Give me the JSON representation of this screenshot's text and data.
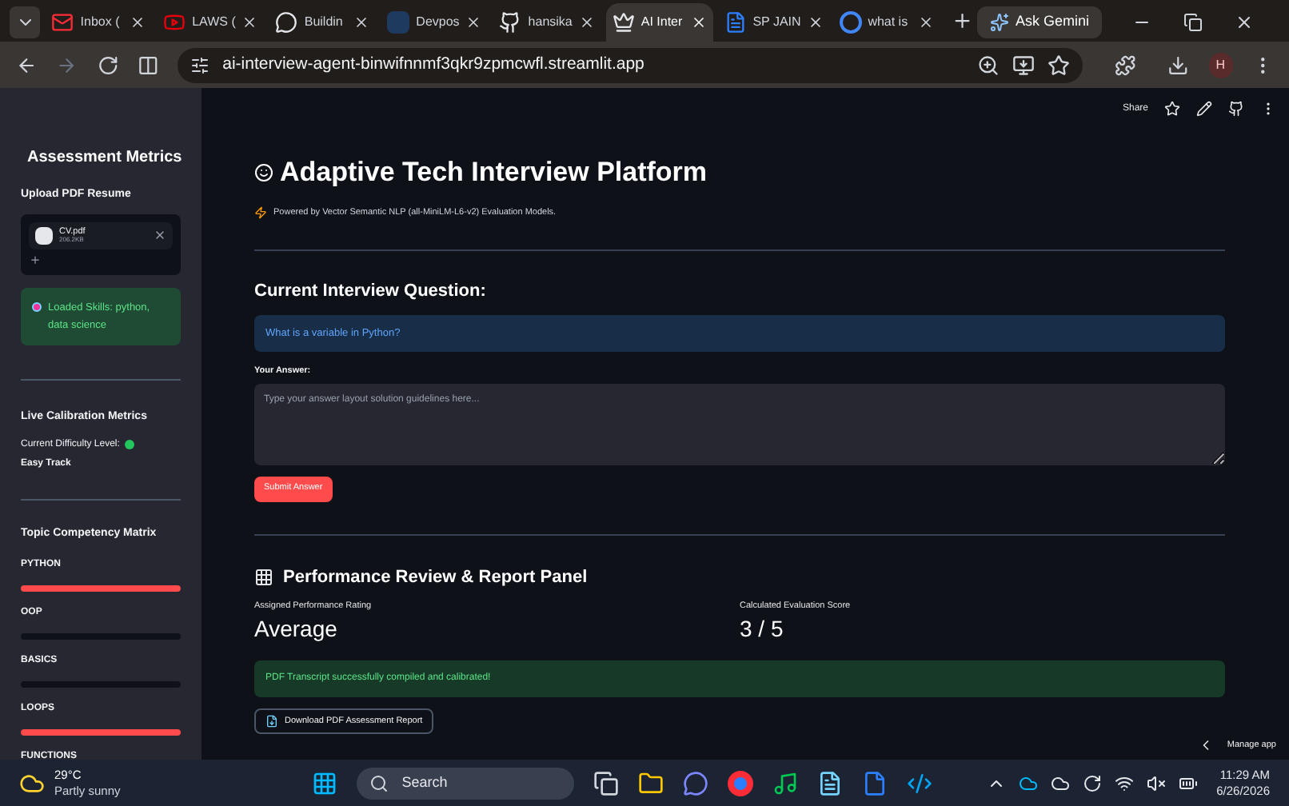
{
  "browser": {
    "tabs": [
      {
        "label": "Inbox (",
        "selected": false
      },
      {
        "label": "LAWS (",
        "selected": false
      },
      {
        "label": "Buildin",
        "selected": false
      },
      {
        "label": "Devpos",
        "selected": false
      },
      {
        "label": "hansika",
        "selected": false
      },
      {
        "label": "AI Inter",
        "selected": true
      },
      {
        "label": "SP JAIN",
        "selected": false
      },
      {
        "label": "what is",
        "selected": false
      }
    ],
    "gemini": "Ask Gemini",
    "url": "ai-interview-agent-binwifnnmf3qkr9zpmcwfl.streamlit.app",
    "profile": "H"
  },
  "sidebar": {
    "title": "Assessment Metrics",
    "upload_label": "Upload PDF Resume",
    "file": {
      "name": "CV.pdf",
      "size": "206.2KB"
    },
    "skills": "Loaded Skills: python, data science",
    "calibration_title": "Live Calibration Metrics",
    "difficulty_label": "Current Difficulty Level:",
    "difficulty_value": "Easy Track",
    "matrix_title": "Topic Competency Matrix",
    "topics": [
      {
        "name": "PYTHON",
        "level": 1
      },
      {
        "name": "OOP",
        "level": 0
      },
      {
        "name": "BASICS",
        "level": 0
      },
      {
        "name": "LOOPS",
        "level": 1
      },
      {
        "name": "FUNCTIONS"
      }
    ]
  },
  "header": {
    "share": "Share"
  },
  "main": {
    "title": "Adaptive Tech Interview Platform",
    "subtitle": "Powered by Vector Semantic NLP (all-MiniLM-L6-v2) Evaluation Models.",
    "question_heading": "Current Interview Question:",
    "question": "What is a variable in Python?",
    "answer_label": "Your Answer:",
    "answer_placeholder": "Type your answer layout solution guidelines here...",
    "submit": "Submit Answer",
    "report_title": "Performance Review & Report Panel",
    "metrics": [
      {
        "label": "Assigned Performance Rating",
        "value": "Average"
      },
      {
        "label": "Calculated Evaluation Score",
        "value": "3 / 5"
      }
    ],
    "success": "PDF Transcript successfully compiled and calibrated!",
    "download": "Download PDF Assessment Report",
    "manage": "Manage app"
  },
  "taskbar": {
    "temperature": "29°C",
    "weather": "Partly sunny",
    "search": "Search",
    "time": "11:29 AM",
    "date": "6/26/2026"
  }
}
